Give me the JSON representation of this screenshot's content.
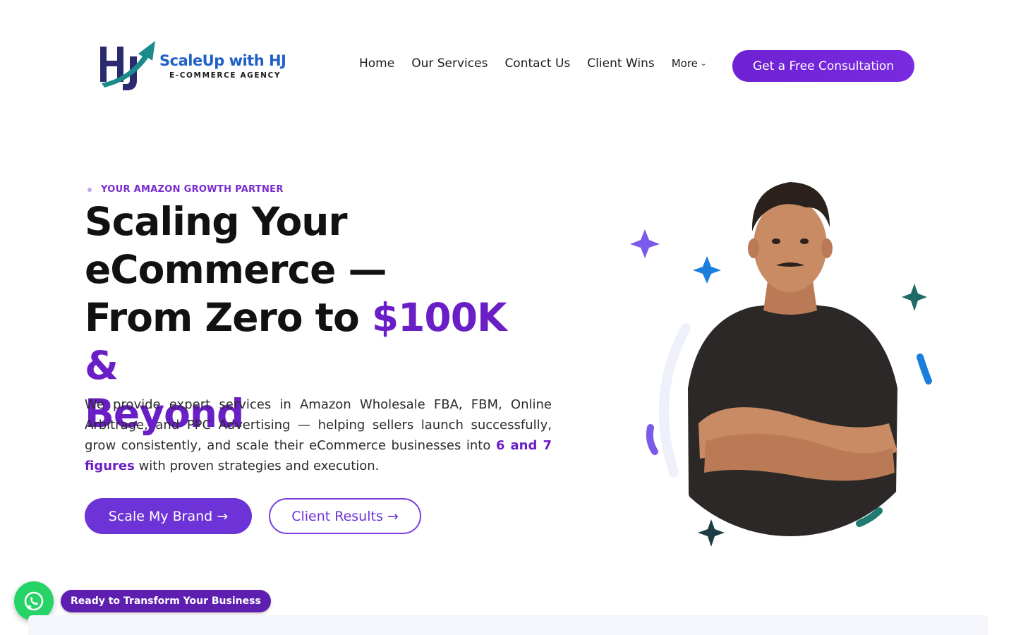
{
  "brand": {
    "name": "ScaleUp with HJ",
    "tagline": "E-COMMERCE AGENCY",
    "monogram": "HJ",
    "colors": {
      "primary": "#6d22d3",
      "logo_blue": "#1f5fc9",
      "logo_teal": "#1a8a8a",
      "logo_navy": "#2a2a6e"
    }
  },
  "nav": {
    "items": [
      "Home",
      "Our Services",
      "Contact Us",
      "Client Wins"
    ],
    "more_label": "More",
    "cta_label": "Get a Free Consultation"
  },
  "hero": {
    "eyebrow": "YOUR AMAZON GROWTH PARTNER",
    "headline_line1": "Scaling Your",
    "headline_line2": "eCommerce —",
    "headline_line3_plain": "From Zero to ",
    "headline_line3_accent": "$100K &",
    "headline_line4_accent": "Beyond",
    "description_part1": "We provide expert services in Amazon Wholesale FBA, FBM, Online Arbitrage, and PPC Advertising — helping sellers launch successfully, grow consistently, and scale their eCommerce businesses into ",
    "description_highlight": "6 and 7 figures",
    "description_part2": " with proven strategies and execution.",
    "primary_button": "Scale My Brand →",
    "secondary_button": "Client Results →",
    "accent_color": "#6a1ec6"
  },
  "whatsapp": {
    "icon": "whatsapp-icon",
    "label": "Ready to Transform Your Business",
    "color": "#25d366"
  }
}
